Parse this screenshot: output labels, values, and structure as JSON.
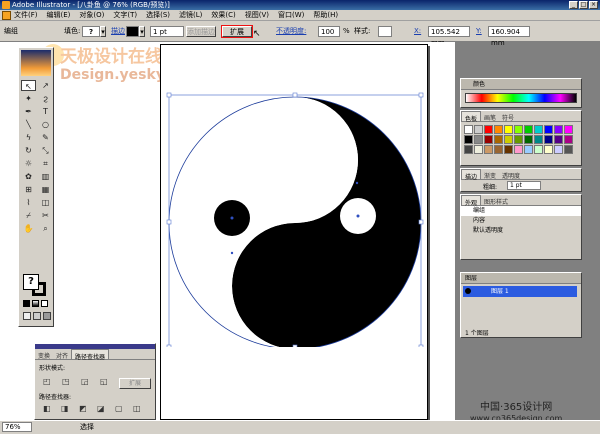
{
  "window": {
    "title": "Adobe Illustrator - [八卦鱼 @ 76% (RGB/预览)]"
  },
  "menu": [
    "文件(F)",
    "编辑(E)",
    "对象(O)",
    "文字(T)",
    "选择(S)",
    "滤镜(L)",
    "效果(C)",
    "视图(V)",
    "窗口(W)",
    "帮助(H)"
  ],
  "control": {
    "mode_label": "编组",
    "fill_label": "填色:",
    "stroke_label": "描边",
    "stroke_weight": "1 pt",
    "placeholder_button": "添加描边",
    "expand_button": "扩展",
    "opacity_label": "不透明度:",
    "opacity_value": "100",
    "percent": "%",
    "style_label": "样式:",
    "x_label": "X:",
    "x_value": "105.542 mm",
    "y_label": "Y:",
    "y_value": "160.904 mm"
  },
  "watermark": {
    "line1": "天极设计在线",
    "line2": "Design.yesky.com"
  },
  "pathfinder": {
    "tabs": [
      "变换",
      "对齐",
      "路径查找器"
    ],
    "shape_modes_label": "形状模式:",
    "pathfinder_label": "路径查找器:",
    "expand_label": "扩展"
  },
  "color_panel": {
    "title": "颜色"
  },
  "swatch_panel": {
    "tabs": [
      "色板",
      "画笔",
      "符号"
    ]
  },
  "stroke_panel": {
    "tabs": [
      "描边",
      "渐变",
      "透明度"
    ],
    "weight_label": "粗细:",
    "weight_value": "1 pt"
  },
  "appearance_panel": {
    "tabs": [
      "外观",
      "图形样式"
    ],
    "items": [
      "编组",
      "内容",
      "默认透明度"
    ]
  },
  "layers_panel": {
    "title": "图层",
    "layer_name": "图层 1",
    "count": "1 个图层"
  },
  "status": {
    "zoom": "76%",
    "tool": "选择"
  },
  "site": {
    "line1": "中国·365设计网",
    "line2": "www.cn365design.com"
  }
}
